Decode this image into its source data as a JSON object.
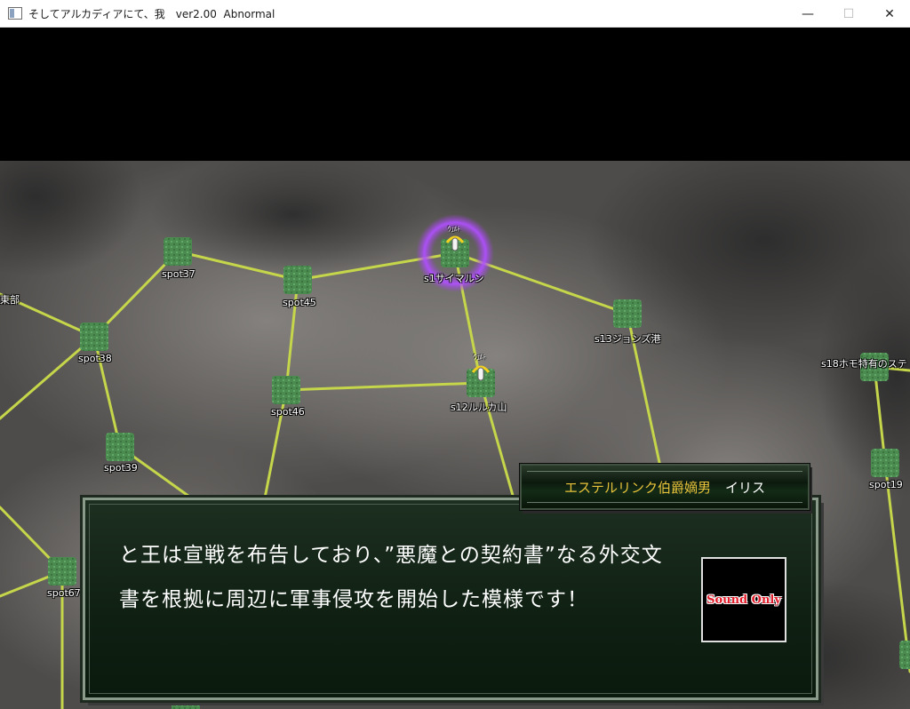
{
  "window": {
    "title": "そしてアルカディアにて、我　ver2.00  Abnormal",
    "minimize_glyph": "—",
    "maximize_glyph": "☐",
    "close_glyph": "✕"
  },
  "map": {
    "nodes": {
      "east_edge": "東部",
      "spot37": "spot37",
      "spot45": "spot45",
      "s1": "s1サイマルン",
      "s13": "s13ジョンズ港",
      "s18": "s18ホモ特有のステ",
      "spot38": "spot38",
      "spot46": "spot46",
      "s12": "s12ルルカ山",
      "spot39": "spot39",
      "spot19": "spot19",
      "spot67": "spot67"
    },
    "unit_tags": {
      "s1": "ｳｪﾙﾄ",
      "s12": "ｳｪﾙﾄ"
    }
  },
  "speaker": {
    "title": "エステルリンク伯爵嫡男",
    "name": "イリス"
  },
  "dialogue": {
    "line1": "と王は宣戦を布告しており、”悪魔との契約書”なる外交文",
    "line2": "書を根拠に周辺に軍事侵攻を開始した模様です！"
  },
  "portrait": {
    "label": "Sound Only"
  },
  "colors": {
    "road": "#c5d64a",
    "node": "#4f8f4f",
    "highlight": "#a040e0",
    "speaker_title": "#e8c23a",
    "portrait_text": "#e21d2b"
  }
}
